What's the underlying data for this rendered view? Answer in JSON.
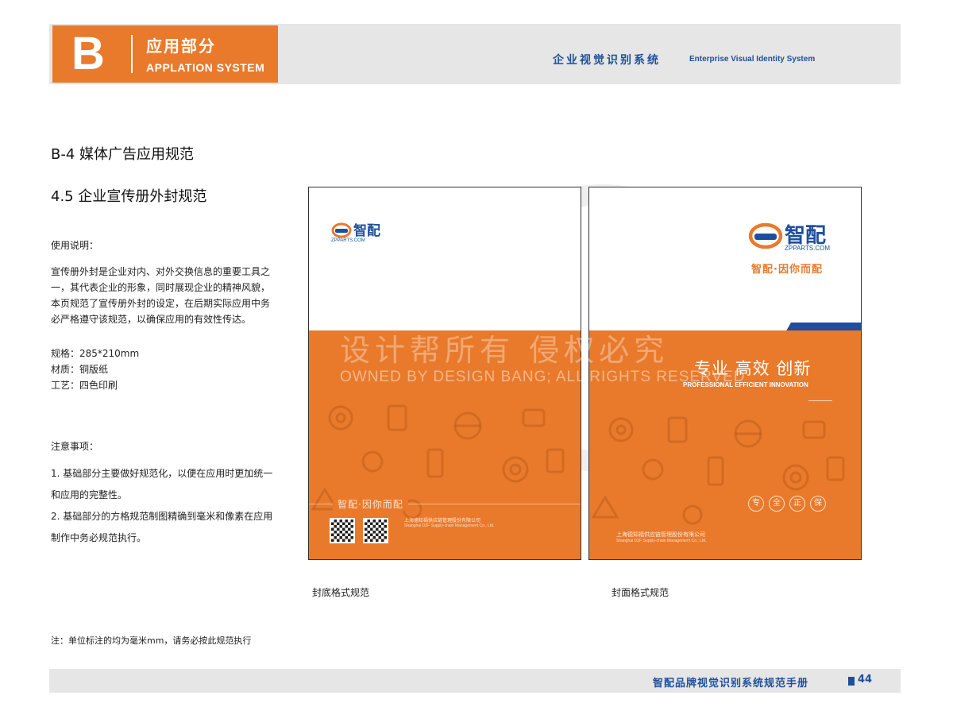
{
  "header": {
    "letter": "B",
    "section_cn": "应用部分",
    "section_en": "APPLATION SYSTEM",
    "right_cn": "企业视觉识别系统",
    "right_en": "Enterprise Visual Identity System"
  },
  "section_title": "B-4  媒体广告应用规范",
  "subsection_title": "4.5 企业宣传册外封规范",
  "usage": {
    "label": "使用说明：",
    "body": "宣传册外封是企业对内、对外交换信息的重要工具之一，其代表企业的形象，同时展现企业的精神风貌，本页规范了宣传册外封的设定，在后期实际应用中务必严格遵守该规范，以确保应用的有效性传达。",
    "spec_size": "规格：285*210mm",
    "spec_material": "材质：铜版纸",
    "spec_process": "工艺：四色印刷"
  },
  "notes": {
    "label": "注意事项：",
    "item1": "1. 基础部分主要做好规范化，以便在应用时更加统一和应用的完整性。",
    "item2": "2. 基础部分的方格规范制图精确到毫米和像素在应用制作中务必规范执行。"
  },
  "footnote": "注：单位标注的均为毫米mm，请务必按此规范执行",
  "back_cover": {
    "logo_text": "智配",
    "logo_sub": "ZPPARTS.COM",
    "slogan": "智配·因你而配",
    "company_cn": "上海德知福供应链管理股份有限公司",
    "company_en": "Shanghai DZF Supply-chain Management Co., Ltd.",
    "caption": "封底格式规范"
  },
  "front_cover": {
    "logo_text": "智配",
    "logo_sub": "ZPPARTS.COM",
    "tagline": "智配·因你而配",
    "headline_cn": "专业 高效 创新",
    "headline_en": "PROFESSIONAL EFFICIENT INNOVATION",
    "badges": [
      "专",
      "全",
      "正",
      "保"
    ],
    "company_cn": "上海德知福供应链管理股份有限公司",
    "company_en": "Shanghai DZF Supply-chain Management Co., Ltd.",
    "caption": "封面格式规范"
  },
  "watermark": {
    "cn": "设计帮所有 侵权必究",
    "en": "OWNED BY DESIGN BANG; ALL RIGHTS RESERVED"
  },
  "footer": {
    "title": "智配品牌视觉识别系统规范手册",
    "page": "44"
  },
  "colors": {
    "orange": "#e97a2b",
    "blue": "#1f4f9c",
    "gray_bar": "#e6e6e6"
  }
}
